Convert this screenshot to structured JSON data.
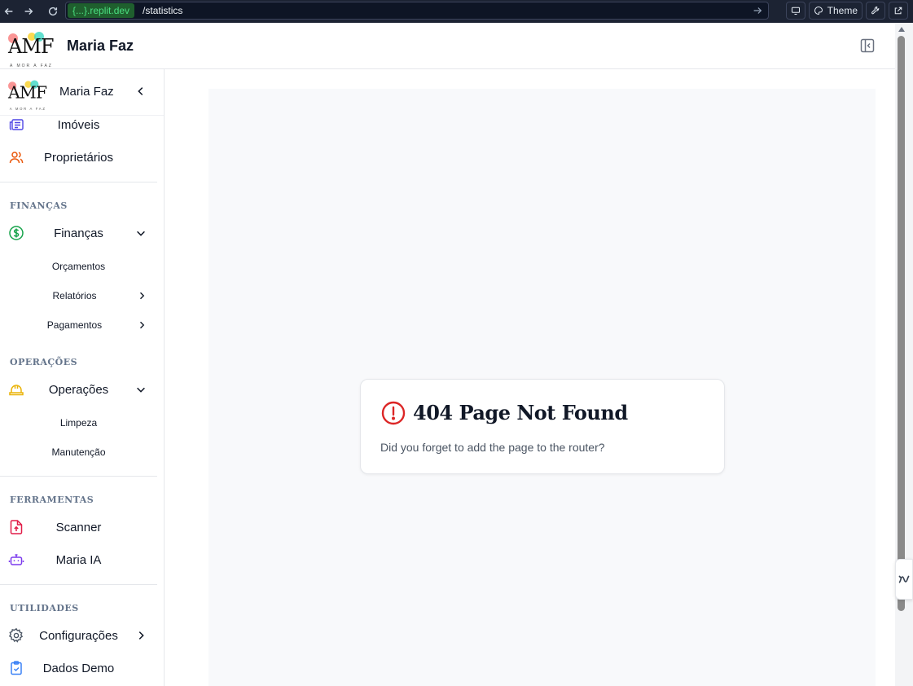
{
  "browser": {
    "url_domain": "{...}.replit.dev",
    "url_path": "/statistics",
    "theme_label": "Theme"
  },
  "header": {
    "logo_text": "AMF",
    "logo_tagline": "A MOR A FAZ",
    "app_title": "Maria Faz"
  },
  "sidebar": {
    "title": "Maria Faz",
    "items": {
      "imoveis": "Imóveis",
      "proprietarios": "Proprietários",
      "financas": "Finanças",
      "orcamentos": "Orçamentos",
      "relatorios": "Relatórios",
      "pagamentos": "Pagamentos",
      "operacoes": "Operações",
      "limpeza": "Limpeza",
      "manutencao": "Manutenção",
      "scanner": "Scanner",
      "maria_ia": "Maria IA",
      "configuracoes": "Configurações",
      "dados_demo": "Dados Demo"
    },
    "sections": {
      "financas": "FINANÇAS",
      "operacoes": "OPERAÇÕES",
      "ferramentas": "FERRAMENTAS",
      "utilidades": "UTILIDADES"
    }
  },
  "not_found": {
    "title": "404 Page Not Found",
    "description": "Did you forget to add the page to the router?"
  },
  "colors": {
    "imoveis_icon": "#4f46e5",
    "proprietarios_icon": "#ea580c",
    "financas_icon": "#16a34a",
    "operacoes_icon": "#eab308",
    "scanner_icon": "#e11d48",
    "maria_ia_icon": "#7c3aed",
    "configuracoes_icon": "#4b5563",
    "dados_demo_icon": "#3b82f6",
    "error": "#dc2626"
  }
}
